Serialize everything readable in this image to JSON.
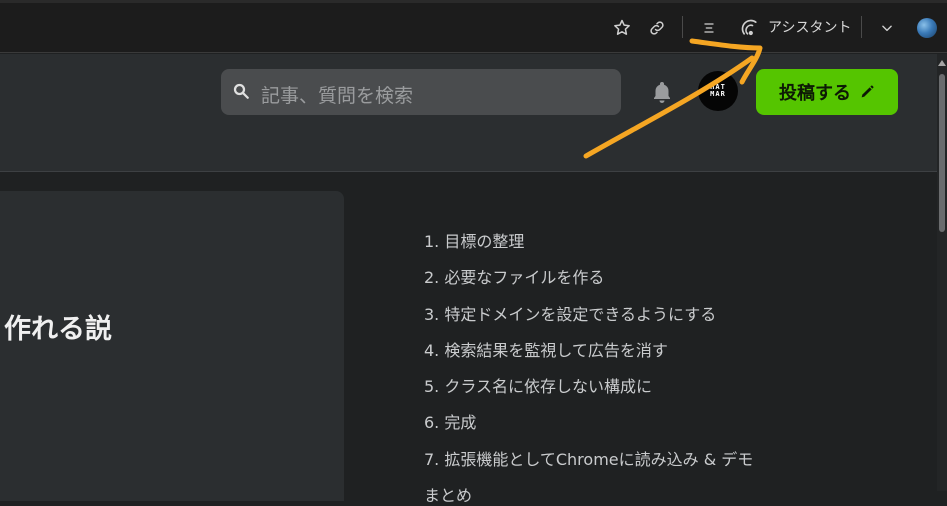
{
  "browser": {
    "assistant_label": "アシスタント",
    "icons": [
      "star-icon",
      "link-icon",
      "reader-icon",
      "assistant-icon",
      "chevron-down-icon",
      "globe-icon"
    ]
  },
  "header": {
    "search_placeholder": "記事、質問を検索",
    "avatar_text_line1": "HAT",
    "avatar_text_line2": "MAR",
    "post_button_label": "投稿する",
    "accent_color": "#55c500"
  },
  "article": {
    "title_fragment": "作れる説"
  },
  "toc": {
    "items": [
      "1. 目標の整理",
      "2. 必要なファイルを作る",
      "3. 特定ドメインを設定できるようにする",
      "4. 検索結果を監視して広告を消す",
      "5. クラス名に依存しない構成に",
      "6. 完成",
      "7. 拡張機能としてChromeに読み込み & デモ",
      "まとめ"
    ]
  },
  "annotation": {
    "color": "#f5a623",
    "icon": "arrow-annotation"
  }
}
